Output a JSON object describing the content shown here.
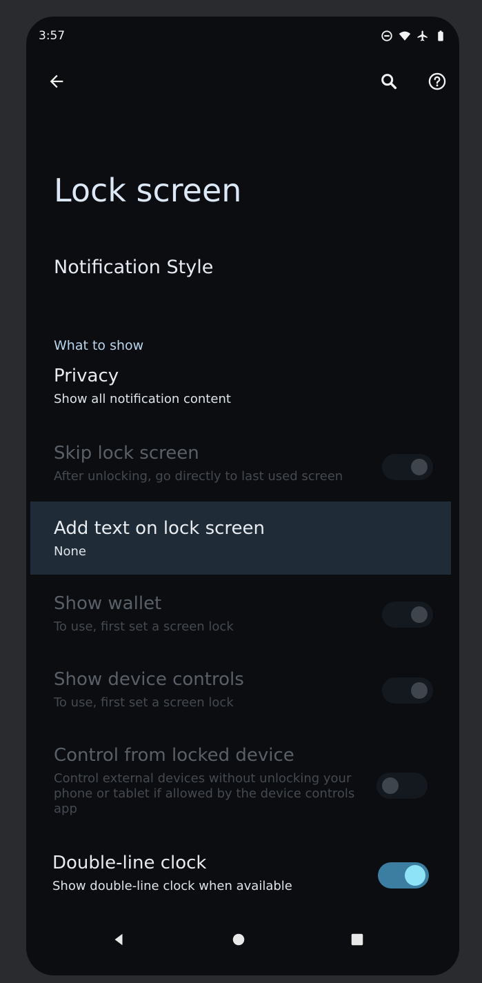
{
  "status_bar": {
    "time": "3:57",
    "icons": [
      "do-not-disturb-icon",
      "wifi-icon",
      "airplane-icon",
      "battery-icon"
    ]
  },
  "toolbar": {
    "back_icon": "arrow-left-icon",
    "search_icon": "search-icon",
    "help_icon": "help-icon"
  },
  "page": {
    "title": "Lock screen",
    "notification_style": "Notification Style",
    "section_label": "What to show"
  },
  "settings": [
    {
      "title": "Privacy",
      "subtitle": "Show all notification content"
    },
    {
      "title": "Skip lock screen",
      "subtitle": "After unlocking, go directly to last used screen",
      "toggle": false
    },
    {
      "title": "Add text on lock screen",
      "subtitle": "None"
    },
    {
      "title": "Show wallet",
      "subtitle": "To use, first set a screen lock",
      "toggle": false
    },
    {
      "title": "Show device controls",
      "subtitle": "To use, first set a screen lock",
      "toggle": false
    },
    {
      "title": "Control from locked device",
      "subtitle_lines": [
        "Control external devices without unlocking your",
        "phone or tablet if allowed by the device controls",
        "app"
      ],
      "toggle": false
    },
    {
      "title": "Double-line clock",
      "subtitle": "Show double-line clock when available",
      "toggle": true
    }
  ],
  "nav_bar": {
    "back_icon": "triangle-back-icon",
    "home_icon": "circle-home-icon",
    "recents_icon": "square-recents-icon"
  },
  "colors": {
    "background": "#0b0d10",
    "accent": "#3c7ea1",
    "title": "#dbe8f5",
    "section_label": "#b9d6ee"
  }
}
